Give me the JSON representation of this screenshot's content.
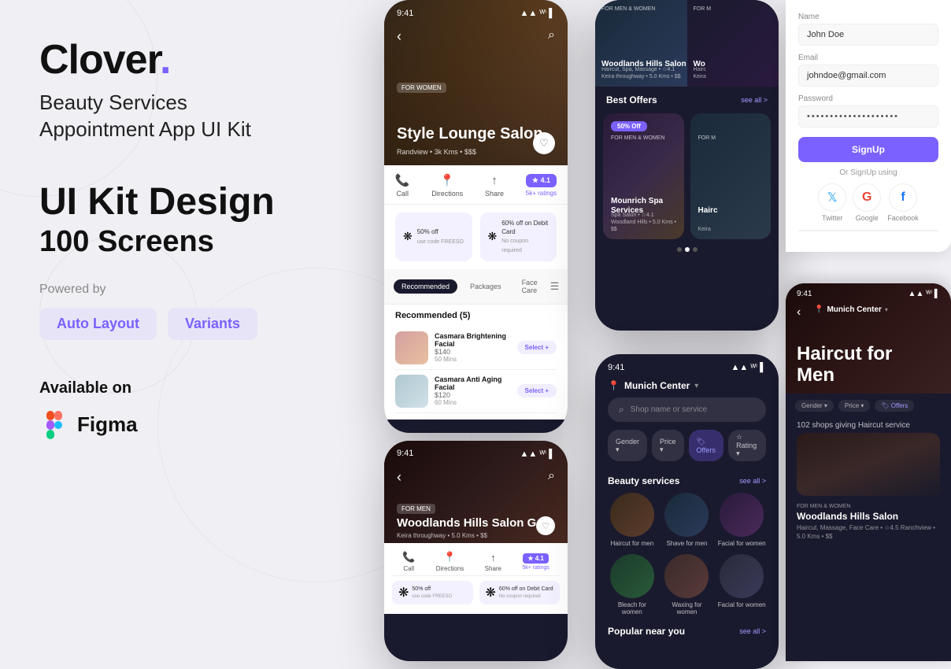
{
  "brand": {
    "name": "Clover",
    "dot": ".",
    "tagline_line1": "Beauty Services",
    "tagline_line2": "Appointment App UI Kit",
    "ui_kit_heading": "UI Kit Design",
    "screens": "100 Screens",
    "powered_by": "Powered by",
    "tags": [
      "Auto Layout",
      "Variants"
    ],
    "available_on": "Available on",
    "figma": "Figma"
  },
  "phone1": {
    "status_time": "9:41",
    "badge": "FOR WOMEN",
    "salon_name": "Style Lounge Salon",
    "salon_sub": "Randview • 3k Kms • $$$",
    "heart": "♡",
    "actions": {
      "call": "Call",
      "directions": "Directions",
      "share": "Share",
      "rating": "4.1",
      "rating_sub": "5k+ ratings"
    },
    "offers": [
      {
        "icon": "❋",
        "text": "50% off\nuse code FREESO"
      },
      {
        "icon": "❋",
        "text": "60% off on Debit Card\nNo coupon required"
      }
    ],
    "tabs": [
      "Recommended",
      "Packages",
      "Face Care"
    ],
    "recommended_count": "Recommended (5)",
    "items": [
      {
        "name": "Casmara Brightening Facial",
        "price": "$140",
        "time": "50 Mins"
      },
      {
        "name": "Casmara Anti Aging Facial",
        "price": "$120",
        "time": "60 Mins"
      }
    ]
  },
  "phone2": {
    "status_time": "9:41",
    "badge": "FOR MEN",
    "salon_name": "Woodlands Hills Salon Go",
    "salon_sub": "Keira throughway • 5.0 Kms • $$",
    "actions": {
      "call": "Call",
      "directions": "Directions",
      "share": "Share",
      "rating": "4.1",
      "rating_sub": "5k+ ratings"
    },
    "offers": [
      {
        "icon": "❋",
        "text": "50% off\nuse code FREESO"
      },
      {
        "icon": "❋",
        "text": "60% off on Debit Card\nNo coupon required"
      }
    ]
  },
  "phone3": {
    "card1_badge": "FOR MEN & WOMEN",
    "card1_name": "Woodlands Hills Salon",
    "card1_sub": "Haircut, Spa, Massage • ☆4.1\nKeira throughway • 5.0 Kms • $$",
    "card2_badge": "FOR M",
    "card2_name": "Wo",
    "card2_sub": "Hairc\nKeira",
    "best_offers": "Best Offers",
    "see_all": "see all >",
    "offer1_discount": "50% Off",
    "offer1_badge": "FOR MEN & WOMEN",
    "offer1_name": "Mounrich Spa Services",
    "offer1_sub": "Spa Salon • ☆4.1\nWoodland Hills • 5.0 Kms • $$",
    "offer2_badge": "FOR M",
    "offer2_name": "Hairc",
    "offer2_sub": "Keira"
  },
  "phone4": {
    "status_time": "9:41",
    "location": "Munich Center",
    "search_placeholder": "Shop name or service",
    "filters": [
      "Gender",
      "Price",
      "Offers",
      "Rating"
    ],
    "beauty_services": "Beauty services",
    "see_all": "see all >",
    "services": [
      {
        "label": "Haircut for men"
      },
      {
        "label": "Shave for men"
      },
      {
        "label": "Facial for women"
      },
      {
        "label": "Bleach for women"
      },
      {
        "label": "Waxing for women"
      },
      {
        "label": "Facial for women"
      }
    ],
    "popular_near": "Popular near you",
    "popular_see_all": "see all >"
  },
  "signup": {
    "name_label": "Name",
    "name_value": "John Doe",
    "email_label": "Email",
    "email_value": "johndoe@gmail.com",
    "password_label": "Password",
    "password_value": "••••••••••••••••••••",
    "signup_btn": "SignUp",
    "or_text": "Or SignUp using",
    "social": [
      {
        "name": "Twitter",
        "icon": "𝕏"
      },
      {
        "name": "Google",
        "icon": "G"
      },
      {
        "name": "Facebook",
        "icon": "f"
      }
    ]
  },
  "munich_card": {
    "status_time": "9:41",
    "location": "Munich Center",
    "title_line1": "Haircut for",
    "title_line2": "Men",
    "filters": [
      "Gender",
      "Price",
      "Offers"
    ],
    "shops_count": "102 shops giving Haircut service",
    "shop_badge": "FOR MEN & WOMEN",
    "shop_name": "Woodlands Hills Salon",
    "shop_sub": "Haircut, Massage, Face Care • ☆4.5\nRanchview • 5.0 Kms • $$"
  }
}
